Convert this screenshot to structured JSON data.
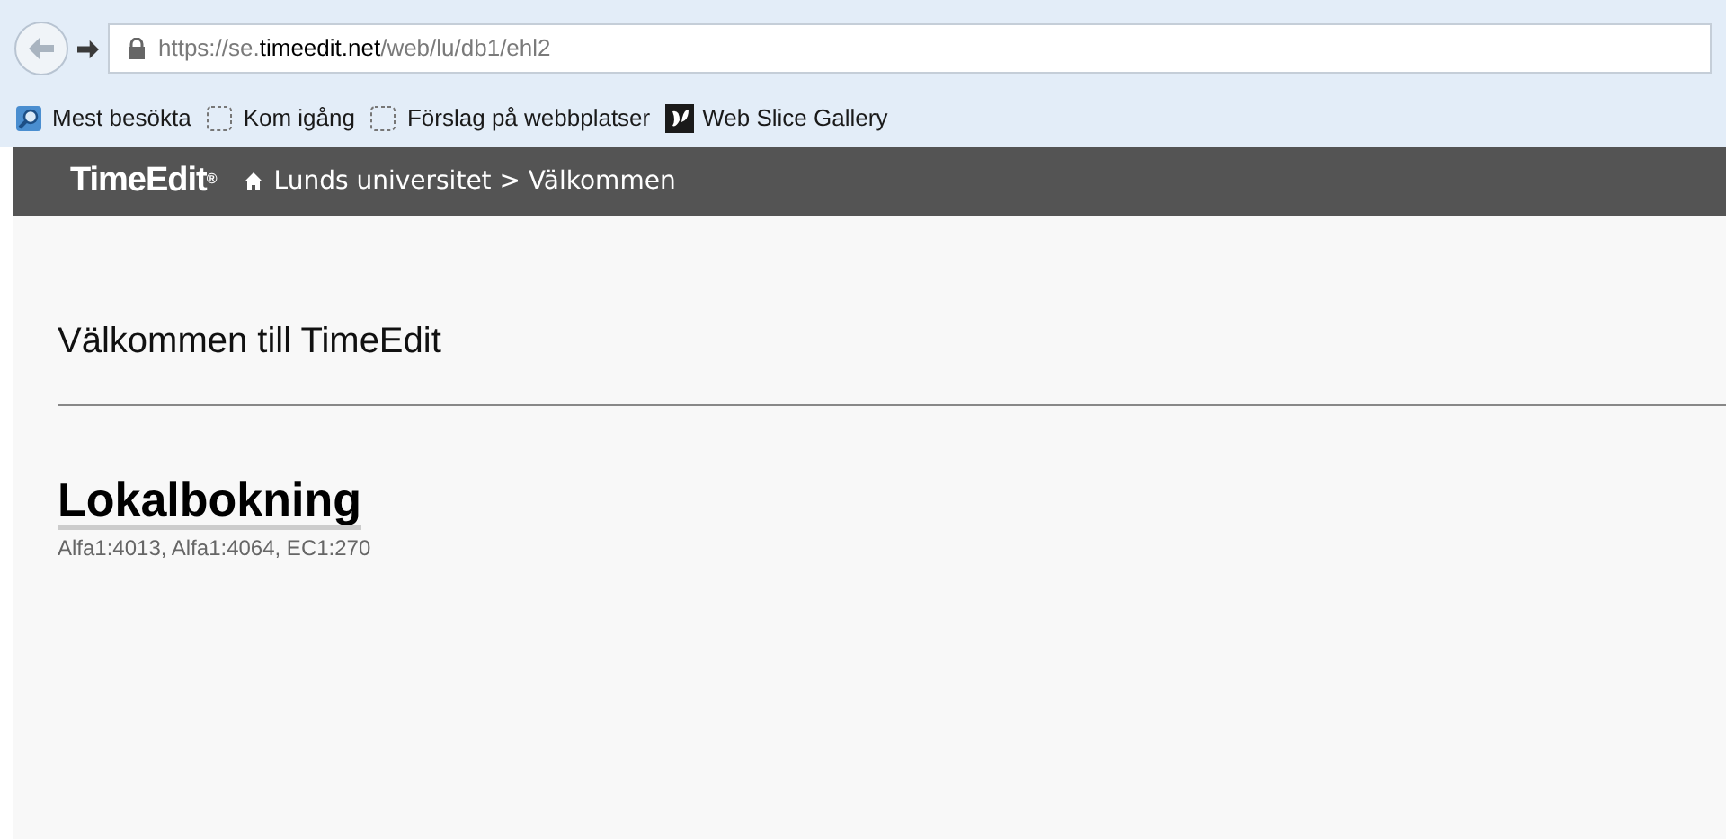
{
  "address_bar": {
    "url_prefix": "https://se.",
    "url_domain": "timeedit.net",
    "url_path": "/web/lu/db1/ehl2"
  },
  "bookmarks": [
    {
      "kind": "search",
      "label": "Mest besökta"
    },
    {
      "kind": "blank",
      "label": "Kom igång"
    },
    {
      "kind": "blank",
      "label": "Förslag på webbplatser"
    },
    {
      "kind": "slice",
      "label": "Web Slice Gallery"
    }
  ],
  "header": {
    "logo": "TimeEdit",
    "logo_mark": "®",
    "breadcrumb": "Lunds universitet > Välkommen"
  },
  "page": {
    "title": "Välkommen till TimeEdit",
    "section_title": "Lokalbokning",
    "section_subtitle": "Alfa1:4013, Alfa1:4064, EC1:270"
  }
}
